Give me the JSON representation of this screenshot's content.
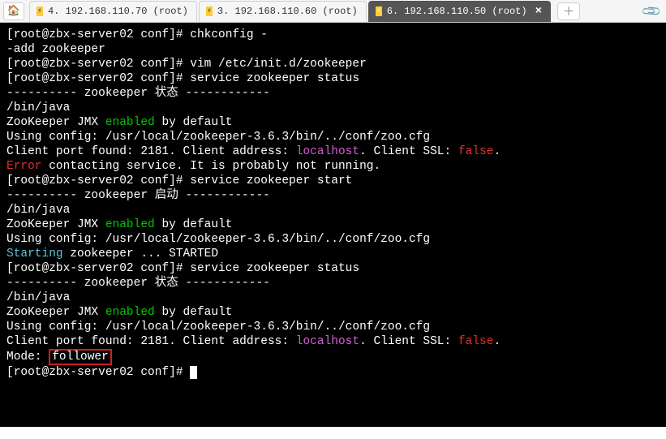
{
  "tabbar": {
    "tabs": [
      {
        "label": "4. 192.168.110.70 (root)"
      },
      {
        "label": "3. 192.168.110.60 (root)"
      },
      {
        "label": "6. 192.168.110.50 (root)"
      }
    ],
    "active_index": 2
  },
  "terminal": {
    "lines": [
      {
        "segments": [
          {
            "t": "[root@zbx-server02 conf]# chkconfig -"
          }
        ]
      },
      {
        "segments": [
          {
            "t": "-add zookeeper"
          }
        ]
      },
      {
        "segments": [
          {
            "t": "[root@zbx-server02 conf]# vim /etc/init.d/zookeeper"
          }
        ]
      },
      {
        "segments": [
          {
            "t": "[root@zbx-server02 conf]# service zookeeper status"
          }
        ]
      },
      {
        "segments": [
          {
            "t": "---------- zookeeper 状态 ------------"
          }
        ]
      },
      {
        "segments": [
          {
            "t": "/bin/java"
          }
        ]
      },
      {
        "segments": [
          {
            "t": "ZooKeeper JMX "
          },
          {
            "t": "enabled",
            "cls": "green"
          },
          {
            "t": " by default"
          }
        ]
      },
      {
        "segments": [
          {
            "t": "Using config: /usr/local/zookeeper-3.6.3/bin/../conf/zoo.cfg"
          }
        ]
      },
      {
        "segments": [
          {
            "t": "Client port found: 2181. Client address: "
          },
          {
            "t": "localhost",
            "cls": "magenta"
          },
          {
            "t": ". Client SSL: "
          },
          {
            "t": "false",
            "cls": "red"
          },
          {
            "t": "."
          }
        ]
      },
      {
        "segments": [
          {
            "t": "Error",
            "cls": "red"
          },
          {
            "t": " contacting service. It is probably not running."
          }
        ]
      },
      {
        "segments": [
          {
            "t": "[root@zbx-server02 conf]# service zookeeper start"
          }
        ]
      },
      {
        "segments": [
          {
            "t": "---------- zookeeper 启动 ------------"
          }
        ]
      },
      {
        "segments": [
          {
            "t": "/bin/java"
          }
        ]
      },
      {
        "segments": [
          {
            "t": "ZooKeeper JMX "
          },
          {
            "t": "enabled",
            "cls": "green"
          },
          {
            "t": " by default"
          }
        ]
      },
      {
        "segments": [
          {
            "t": "Using config: /usr/local/zookeeper-3.6.3/bin/../conf/zoo.cfg"
          }
        ]
      },
      {
        "segments": [
          {
            "t": "Starting",
            "cls": "skyblue"
          },
          {
            "t": " zookeeper ... STARTED"
          }
        ]
      },
      {
        "segments": [
          {
            "t": "[root@zbx-server02 conf]# service zookeeper status"
          }
        ]
      },
      {
        "segments": [
          {
            "t": "---------- zookeeper 状态 ------------"
          }
        ]
      },
      {
        "segments": [
          {
            "t": "/bin/java"
          }
        ]
      },
      {
        "segments": [
          {
            "t": "ZooKeeper JMX "
          },
          {
            "t": "enabled",
            "cls": "green"
          },
          {
            "t": " by default"
          }
        ]
      },
      {
        "segments": [
          {
            "t": "Using config: /usr/local/zookeeper-3.6.3/bin/../conf/zoo.cfg"
          }
        ]
      },
      {
        "segments": [
          {
            "t": "Client port found: 2181. Client address: "
          },
          {
            "t": "localhost",
            "cls": "magenta"
          },
          {
            "t": ". Client SSL: "
          },
          {
            "t": "false",
            "cls": "red"
          },
          {
            "t": "."
          }
        ]
      },
      {
        "segments": [
          {
            "t": "Mode: "
          },
          {
            "t": "follower",
            "box": true
          }
        ]
      },
      {
        "segments": [
          {
            "t": "[root@zbx-server02 conf]# "
          }
        ],
        "cursor": true
      }
    ]
  },
  "footer": {
    "text": ""
  }
}
